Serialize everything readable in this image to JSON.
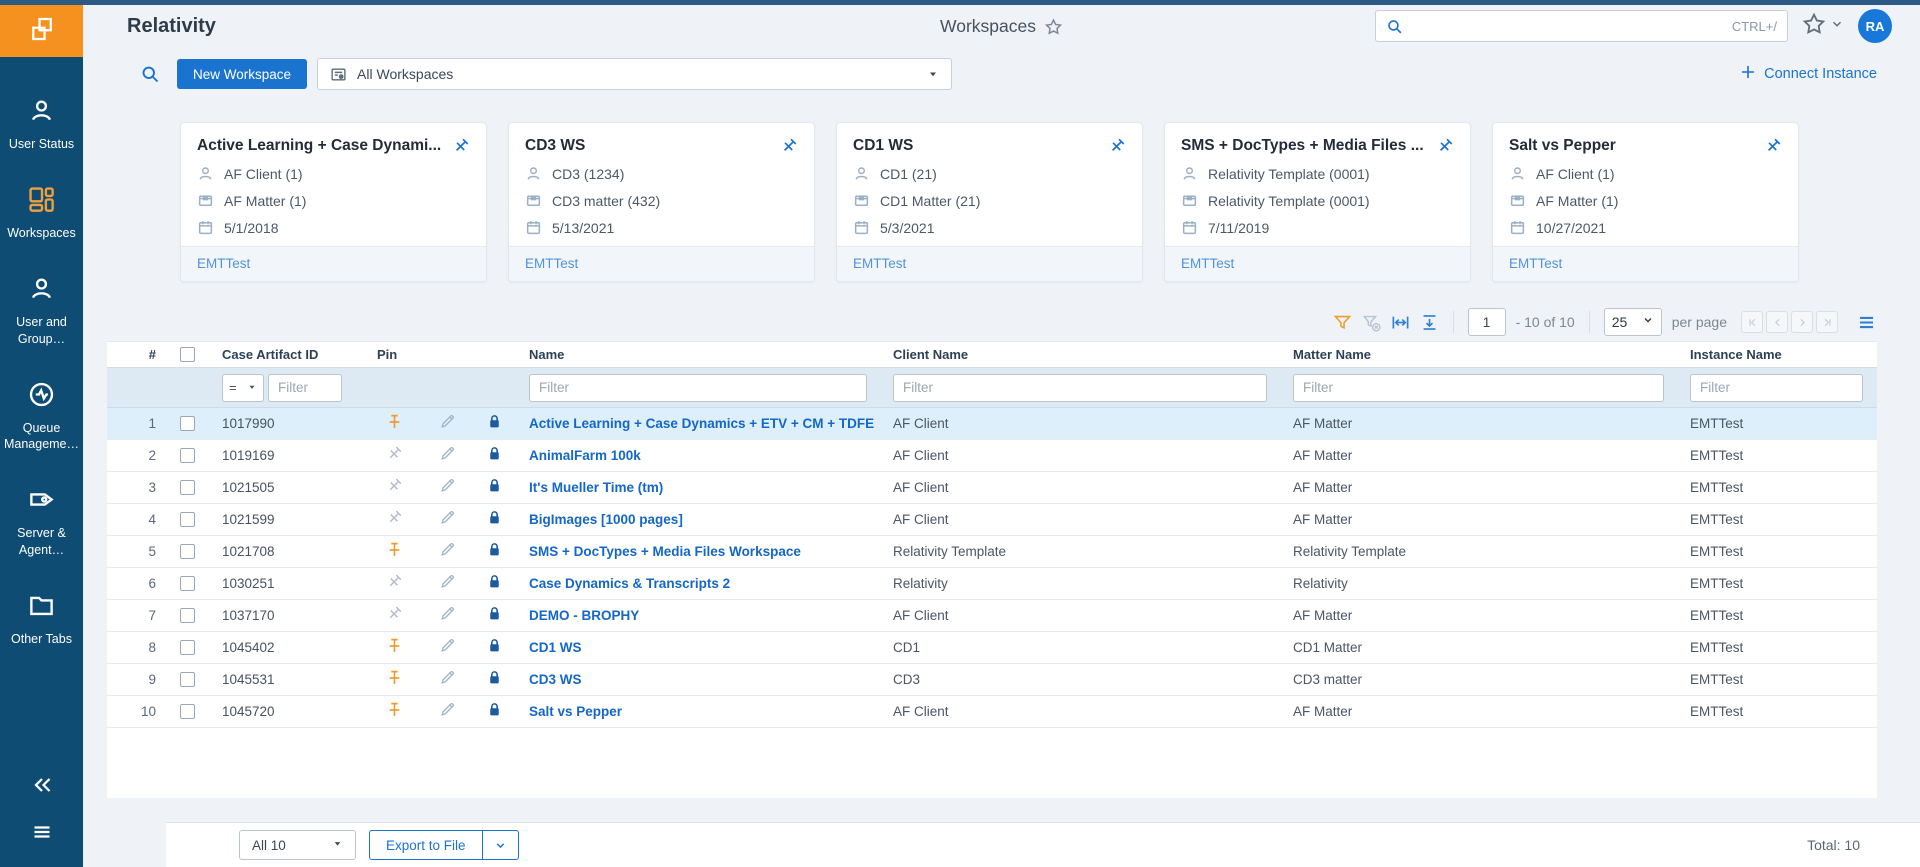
{
  "theme": {
    "accent": "#1a73cf",
    "orange": "#f5911e",
    "navy": "#0f4c74",
    "pin_orange": "#f09b2e"
  },
  "topbar": {
    "app_title": "Relativity",
    "page_title": "Workspaces",
    "search_placeholder": "",
    "search_shortcut": "CTRL+/",
    "avatar_initials": "RA"
  },
  "subheader": {
    "new_workspace_label": "New Workspace",
    "view_selector_label": "All Workspaces",
    "connect_instance_label": "Connect Instance"
  },
  "sidebar": {
    "items": [
      {
        "label": "User Status",
        "icon": "user-status-icon",
        "active": false
      },
      {
        "label": "Workspaces",
        "icon": "workspaces-icon",
        "active": true
      },
      {
        "label": "User and Group…",
        "icon": "user-group-icon",
        "active": false
      },
      {
        "label": "Queue Manageme…",
        "icon": "queue-management-icon",
        "active": false
      },
      {
        "label": "Server & Agent…",
        "icon": "server-agent-icon",
        "active": false
      },
      {
        "label": "Other Tabs",
        "icon": "other-tabs-icon",
        "active": false
      }
    ]
  },
  "cards": [
    {
      "title": "Active Learning + Case Dynami...",
      "client": "AF Client (1)",
      "matter": "AF Matter (1)",
      "date": "5/1/2018",
      "instance": "EMTTest",
      "pinned": true
    },
    {
      "title": "CD3 WS",
      "client": "CD3 (1234)",
      "matter": "CD3 matter (432)",
      "date": "5/13/2021",
      "instance": "EMTTest",
      "pinned": true
    },
    {
      "title": "CD1 WS",
      "client": "CD1 (21)",
      "matter": "CD1 Matter (21)",
      "date": "5/3/2021",
      "instance": "EMTTest",
      "pinned": true
    },
    {
      "title": "SMS + DocTypes + Media Files ...",
      "client": "Relativity Template (0001)",
      "matter": "Relativity Template (0001)",
      "date": "7/11/2019",
      "instance": "EMTTest",
      "pinned": true
    },
    {
      "title": "Salt vs Pepper",
      "client": "AF Client (1)",
      "matter": "AF Matter (1)",
      "date": "10/27/2021",
      "instance": "EMTTest",
      "pinned": true
    }
  ],
  "toolbar": {
    "page_value": "1",
    "range_text": "- 10  of  10",
    "page_size": "25",
    "per_page_label": "per page"
  },
  "table": {
    "columns": [
      "#",
      "Case Artifact ID",
      "Pin",
      "Name",
      "Client Name",
      "Matter Name",
      "Instance Name"
    ],
    "filter_placeholder": "Filter",
    "operator": "=",
    "rows": [
      {
        "num": "1",
        "artifact_id": "1017990",
        "pinned": true,
        "name": "Active Learning + Case Dynamics + ETV + CM + TDFE",
        "client": "AF Client",
        "matter": "AF Matter",
        "instance": "EMTTest",
        "highlighted": true
      },
      {
        "num": "2",
        "artifact_id": "1019169",
        "pinned": false,
        "name": "AnimalFarm 100k",
        "client": "AF Client",
        "matter": "AF Matter",
        "instance": "EMTTest",
        "highlighted": false
      },
      {
        "num": "3",
        "artifact_id": "1021505",
        "pinned": false,
        "name": "It's Mueller Time (tm)",
        "client": "AF Client",
        "matter": "AF Matter",
        "instance": "EMTTest",
        "highlighted": false
      },
      {
        "num": "4",
        "artifact_id": "1021599",
        "pinned": false,
        "name": "BigImages [1000 pages]",
        "client": "AF Client",
        "matter": "AF Matter",
        "instance": "EMTTest",
        "highlighted": false
      },
      {
        "num": "5",
        "artifact_id": "1021708",
        "pinned": true,
        "name": "SMS + DocTypes + Media Files Workspace",
        "client": "Relativity Template",
        "matter": "Relativity Template",
        "instance": "EMTTest",
        "highlighted": false
      },
      {
        "num": "6",
        "artifact_id": "1030251",
        "pinned": false,
        "name": "Case Dynamics & Transcripts 2",
        "client": "Relativity",
        "matter": "Relativity",
        "instance": "EMTTest",
        "highlighted": false
      },
      {
        "num": "7",
        "artifact_id": "1037170",
        "pinned": false,
        "name": "DEMO - BROPHY",
        "client": "AF Client",
        "matter": "AF Matter",
        "instance": "EMTTest",
        "highlighted": false
      },
      {
        "num": "8",
        "artifact_id": "1045402",
        "pinned": true,
        "name": "CD1 WS",
        "client": "CD1",
        "matter": "CD1 Matter",
        "instance": "EMTTest",
        "highlighted": false
      },
      {
        "num": "9",
        "artifact_id": "1045531",
        "pinned": true,
        "name": "CD3 WS",
        "client": "CD3",
        "matter": "CD3 matter",
        "instance": "EMTTest",
        "highlighted": false
      },
      {
        "num": "10",
        "artifact_id": "1045720",
        "pinned": true,
        "name": "Salt vs Pepper",
        "client": "AF Client",
        "matter": "AF Matter",
        "instance": "EMTTest",
        "highlighted": false
      }
    ]
  },
  "footer": {
    "selection_label": "All 10",
    "export_label": "Export to File",
    "total_text": "Total: 10"
  }
}
